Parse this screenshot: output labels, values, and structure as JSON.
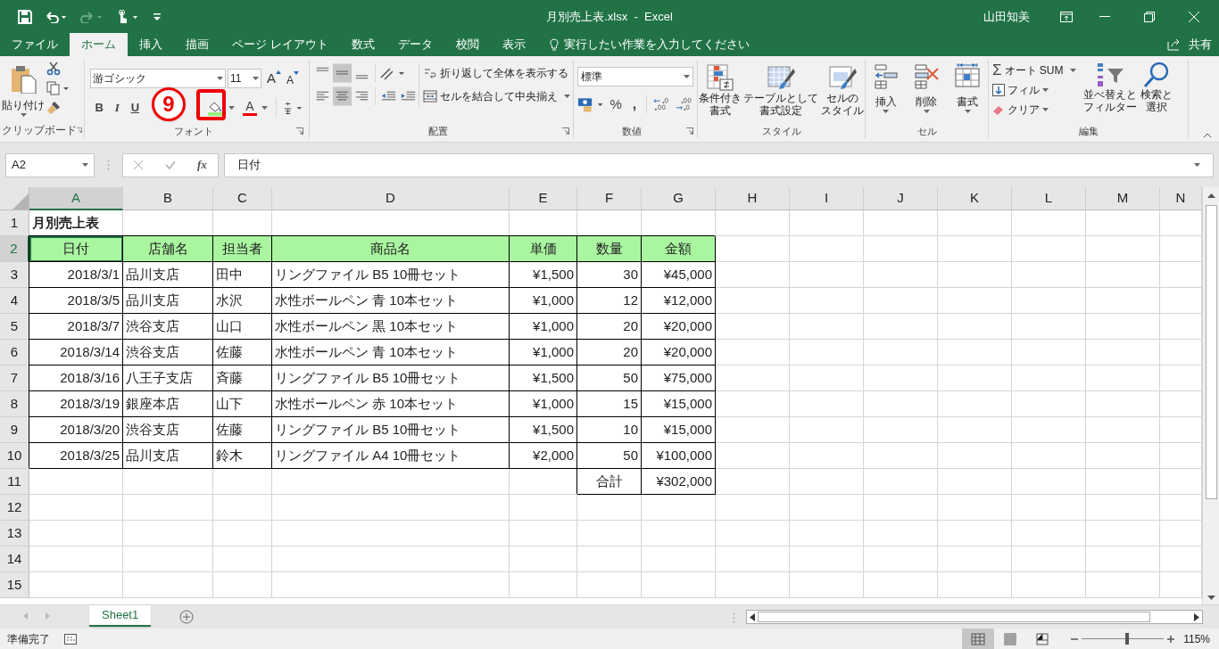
{
  "window": {
    "title": "月別売上表.xlsx  -  Excel",
    "user": "山田知美"
  },
  "tabs": [
    {
      "label": "ファイル",
      "selected": false
    },
    {
      "label": "ホーム",
      "selected": true
    },
    {
      "label": "挿入",
      "selected": false
    },
    {
      "label": "描画",
      "selected": false
    },
    {
      "label": "ページ レイアウト",
      "selected": false
    },
    {
      "label": "数式",
      "selected": false
    },
    {
      "label": "データ",
      "selected": false
    },
    {
      "label": "校閲",
      "selected": false
    },
    {
      "label": "表示",
      "selected": false
    }
  ],
  "tell_me": {
    "placeholder": "実行したい作業を入力してください"
  },
  "share": "共有",
  "ribbon": {
    "clipboard": {
      "label": "クリップボード",
      "paste": "貼り付け"
    },
    "font": {
      "label": "フォント",
      "name": "游ゴシック",
      "size": "11",
      "grow": "A",
      "shrink": "A",
      "bold": "B",
      "italic": "I",
      "underline": "U",
      "font_color": "A"
    },
    "alignment": {
      "label": "配置",
      "wrap": "折り返して全体を表示する",
      "merge": "セルを結合して中央揃え"
    },
    "number": {
      "label": "数値",
      "format": "標準",
      "percent": "%",
      "comma": ","
    },
    "styles": {
      "label": "スタイル",
      "conditional": [
        "条件付き",
        "書式"
      ],
      "table": [
        "テーブルとして",
        "書式設定"
      ],
      "cell_styles": [
        "セルの",
        "スタイル"
      ]
    },
    "cells": {
      "label": "セル",
      "insert": "挿入",
      "delete": "削除",
      "format": "書式"
    },
    "editing": {
      "label": "編集",
      "sigma": "Σ",
      "autosum": "オート SUM",
      "fill": "フィル",
      "clear": "クリア",
      "sort": [
        "並べ替えと",
        "フィルター"
      ],
      "find": [
        "検索と",
        "選択"
      ]
    }
  },
  "annotation": {
    "label": "9"
  },
  "formula_bar": {
    "name_box": "A2",
    "fx": "fx",
    "content": "日付"
  },
  "columns": [
    {
      "label": "A",
      "selected": true
    },
    {
      "label": "B",
      "selected": false
    },
    {
      "label": "C",
      "selected": false
    },
    {
      "label": "D",
      "selected": false
    },
    {
      "label": "E",
      "selected": false
    },
    {
      "label": "F",
      "selected": false
    },
    {
      "label": "G",
      "selected": false
    },
    {
      "label": "H",
      "selected": false
    },
    {
      "label": "I",
      "selected": false
    },
    {
      "label": "J",
      "selected": false
    },
    {
      "label": "K",
      "selected": false
    },
    {
      "label": "L",
      "selected": false
    },
    {
      "label": "M",
      "selected": false
    },
    {
      "label": "N",
      "selected": false
    }
  ],
  "rows": [
    {
      "number": "1",
      "selected": false,
      "kind": "title",
      "cells": [
        "月別売上表"
      ]
    },
    {
      "number": "2",
      "selected": true,
      "kind": "header",
      "cells": [
        "日付",
        "店舗名",
        "担当者",
        "商品名",
        "単価",
        "数量",
        "金額"
      ]
    },
    {
      "number": "3",
      "selected": false,
      "kind": "data",
      "cells": [
        "2018/3/1",
        "品川支店",
        "田中",
        "リングファイル B5 10冊セット",
        "¥1,500",
        "30",
        "¥45,000"
      ]
    },
    {
      "number": "4",
      "selected": false,
      "kind": "data",
      "cells": [
        "2018/3/5",
        "品川支店",
        "水沢",
        "水性ボールペン 青 10本セット",
        "¥1,000",
        "12",
        "¥12,000"
      ]
    },
    {
      "number": "5",
      "selected": false,
      "kind": "data",
      "cells": [
        "2018/3/7",
        "渋谷支店",
        "山口",
        "水性ボールペン 黒 10本セット",
        "¥1,000",
        "20",
        "¥20,000"
      ]
    },
    {
      "number": "6",
      "selected": false,
      "kind": "data",
      "cells": [
        "2018/3/14",
        "渋谷支店",
        "佐藤",
        "水性ボールペン 青 10本セット",
        "¥1,000",
        "20",
        "¥20,000"
      ]
    },
    {
      "number": "7",
      "selected": false,
      "kind": "data",
      "cells": [
        "2018/3/16",
        "八王子支店",
        "斉藤",
        "リングファイル B5 10冊セット",
        "¥1,500",
        "50",
        "¥75,000"
      ]
    },
    {
      "number": "8",
      "selected": false,
      "kind": "data",
      "cells": [
        "2018/3/19",
        "銀座本店",
        "山下",
        "水性ボールペン 赤 10本セット",
        "¥1,000",
        "15",
        "¥15,000"
      ]
    },
    {
      "number": "9",
      "selected": false,
      "kind": "data",
      "cells": [
        "2018/3/20",
        "渋谷支店",
        "佐藤",
        "リングファイル B5 10冊セット",
        "¥1,500",
        "10",
        "¥15,000"
      ]
    },
    {
      "number": "10",
      "selected": false,
      "kind": "data",
      "cells": [
        "2018/3/25",
        "品川支店",
        "鈴木",
        "リングファイル A4 10冊セット",
        "¥2,000",
        "50",
        "¥100,000"
      ]
    },
    {
      "number": "11",
      "selected": false,
      "kind": "total",
      "cells": [
        "合計",
        "¥302,000"
      ]
    },
    {
      "number": "12",
      "selected": false,
      "kind": "empty"
    },
    {
      "number": "13",
      "selected": false,
      "kind": "empty"
    },
    {
      "number": "14",
      "selected": false,
      "kind": "empty"
    },
    {
      "number": "15",
      "selected": false,
      "kind": "empty"
    }
  ],
  "sheets": [
    {
      "label": "Sheet1",
      "selected": true
    }
  ],
  "status": {
    "text": "準備完了"
  },
  "views": [
    {
      "kind": "normal",
      "selected": true
    },
    {
      "kind": "page_layout",
      "selected": false
    },
    {
      "kind": "page_break",
      "selected": false
    }
  ],
  "zoom": {
    "label": "115%",
    "level": 0.55
  }
}
